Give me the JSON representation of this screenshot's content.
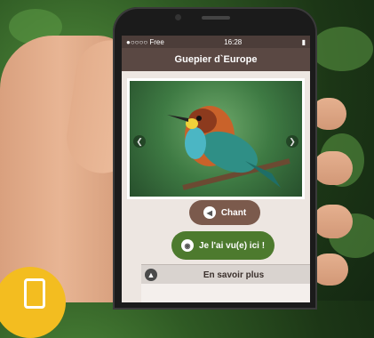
{
  "status_bar": {
    "carrier": "●○○○○ Free",
    "time": "16:28",
    "battery": "▮"
  },
  "navbar": {
    "title": "Guepier d`Europe"
  },
  "gallery": {
    "prev_icon": "chevron-left-icon",
    "next_icon": "chevron-right-icon"
  },
  "buttons": {
    "chant_label": "Chant",
    "chant_icon": "speaker-icon",
    "seen_label": "Je l'ai vu(e) ici !",
    "seen_icon": "eye-icon"
  },
  "more": {
    "label": "En savoir plus",
    "icon": "arrow-up-icon"
  },
  "colors": {
    "navbar": "#5a4843",
    "chant_button": "#7b5a4c",
    "seen_button": "#4d7a2e",
    "badge": "#f3bd20"
  }
}
